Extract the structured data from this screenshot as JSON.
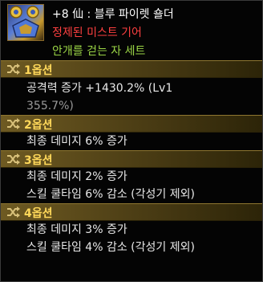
{
  "item": {
    "line1": "+8 仙 : 블루 파이렛 숄더",
    "line2": "정제된 미스트 기어",
    "line3": "안개를 걷는 자 세트"
  },
  "options": [
    {
      "title": "1옵션",
      "lines": [
        "공격력 증가 +1430.2% (Lv1",
        "355.7%)"
      ]
    },
    {
      "title": "2옵션",
      "lines": [
        "최종 데미지 6% 증가"
      ]
    },
    {
      "title": "3옵션",
      "lines": [
        "최종 데미지 2% 증가",
        "스킬 쿨타임 6% 감소 (각성기 제외)"
      ]
    },
    {
      "title": "4옵션",
      "lines": [
        "최종 데미지 3% 증가",
        "스킬 쿨타임 4% 감소 (각성기 제외)"
      ]
    }
  ],
  "colors": {
    "item_name": "#ffffff",
    "item_grade": "#ff4040",
    "set_name": "#9bd646",
    "section_title": "#ffd85a",
    "option_text": "#e8e8e8",
    "option_subtext": "#9a9a9a"
  },
  "icons": {
    "item": "blue-pirate-shoulder-icon",
    "section": "shuffle-icon"
  }
}
